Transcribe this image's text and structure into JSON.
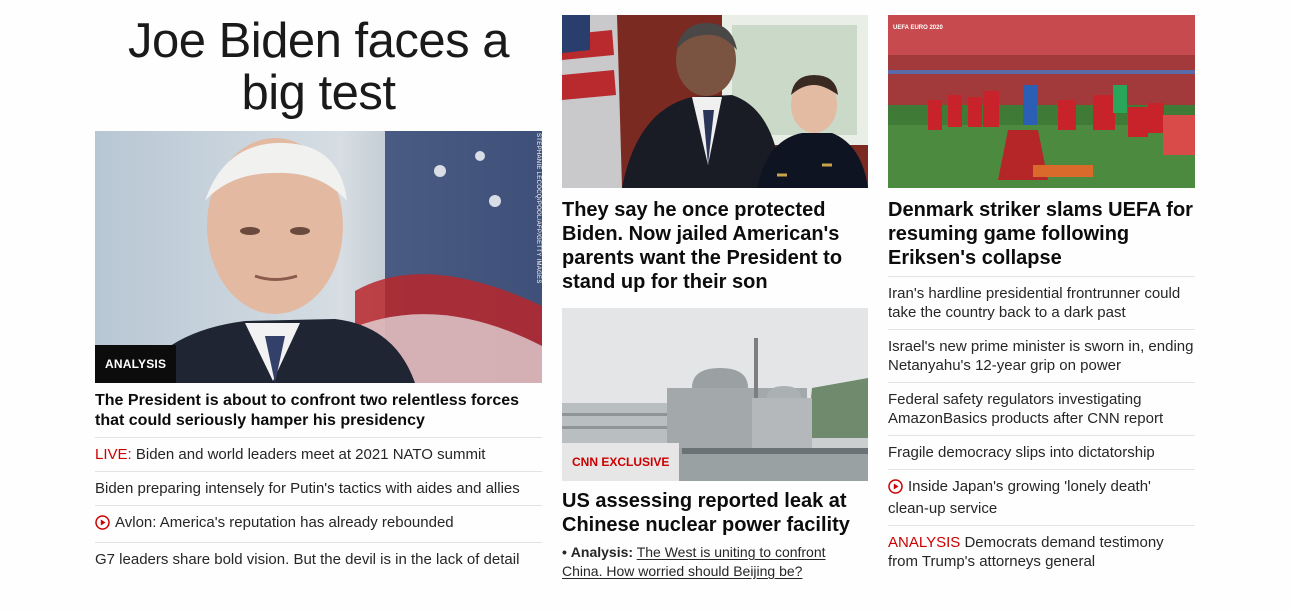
{
  "col1": {
    "headline": "Joe Biden faces a big test",
    "badge": "ANALYSIS",
    "photo_credit": "STEPHANIE LECOCQ/POOL/AFP/GETTY IMAGES",
    "lead": "The President is about to confront two relentless forces that could seriously hamper his presidency",
    "links": [
      {
        "prefix": "LIVE:",
        "text": "Biden and world leaders meet at 2021 NATO summit"
      },
      {
        "text": "Biden preparing intensely for Putin's tactics with aides and allies"
      },
      {
        "video": true,
        "text": "Avlon: America's reputation has already rebounded"
      },
      {
        "text": "G7 leaders share bold vision. But the devil is in the lack of detail"
      }
    ]
  },
  "col2": {
    "story1_title": "They say he once protected Biden. Now jailed American's parents want the President to stand up for their son",
    "badge": "CNN EXCLUSIVE",
    "story2_title": "US assessing reported leak at Chinese nuclear power facility",
    "sub_bullet": "•",
    "sub_label": "Analysis:",
    "sub_text": "The West is uniting to confront China. How worried should Beijing be?"
  },
  "col3": {
    "overlay_text": "UEFA EURO 2020",
    "title": "Denmark striker slams UEFA for resuming game following Eriksen's collapse",
    "links": [
      {
        "text": "Iran's hardline presidential frontrunner could take the country back to a dark past"
      },
      {
        "text": "Israel's new prime minister is sworn in, ending Netanyahu's 12-year grip on power"
      },
      {
        "text": "Federal safety regulators investigating AmazonBasics products after CNN report"
      },
      {
        "text": "Fragile democracy slips into dictatorship"
      },
      {
        "video": true,
        "text": "Inside Japan's growing 'lonely death' clean-up service"
      },
      {
        "prefix": "ANALYSIS",
        "text": "Democrats demand testimony from Trump's attorneys general"
      }
    ]
  },
  "colors": {
    "red": "#cc0000",
    "text": "#0c0c0c",
    "divider": "#e3e3e3"
  }
}
